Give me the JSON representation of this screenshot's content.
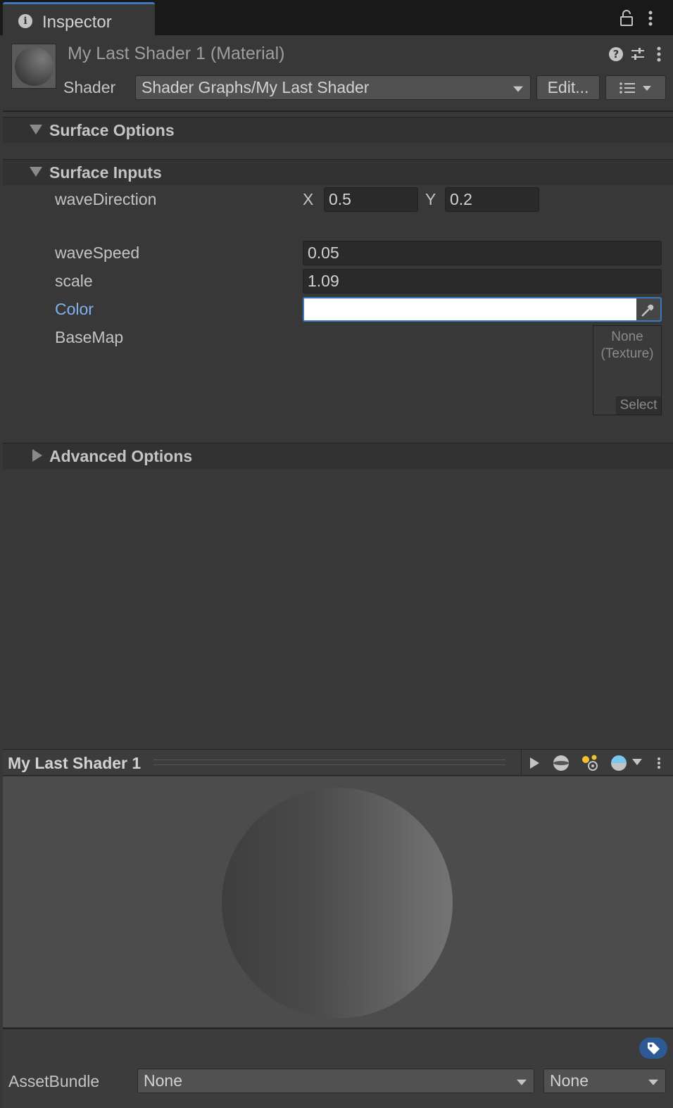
{
  "tab": {
    "label": "Inspector"
  },
  "header": {
    "title": "My Last Shader 1 (Material)",
    "shader_label": "Shader",
    "shader_value": "Shader Graphs/My Last Shader",
    "edit_label": "Edit..."
  },
  "sections": {
    "surface_options": "Surface Options",
    "surface_inputs": "Surface Inputs",
    "advanced_options": "Advanced Options"
  },
  "properties": {
    "wave_direction": {
      "label": "waveDirection",
      "x_label": "X",
      "x_value": "0.5",
      "y_label": "Y",
      "y_value": "0.2"
    },
    "wave_speed": {
      "label": "waveSpeed",
      "value": "0.05"
    },
    "scale": {
      "label": "scale",
      "value": "1.09"
    },
    "color": {
      "label": "Color",
      "value_hex": "#ffffff"
    },
    "base_map": {
      "label": "BaseMap",
      "texture_line1": "None",
      "texture_line2": "(Texture)",
      "select_label": "Select"
    }
  },
  "preview": {
    "title": "My Last Shader 1"
  },
  "footer": {
    "asset_bundle_label": "AssetBundle",
    "bundle_value": "None",
    "variant_value": "None"
  },
  "colors": {
    "accent": "#3a79bb",
    "label_highlight": "#7fb2ee"
  }
}
